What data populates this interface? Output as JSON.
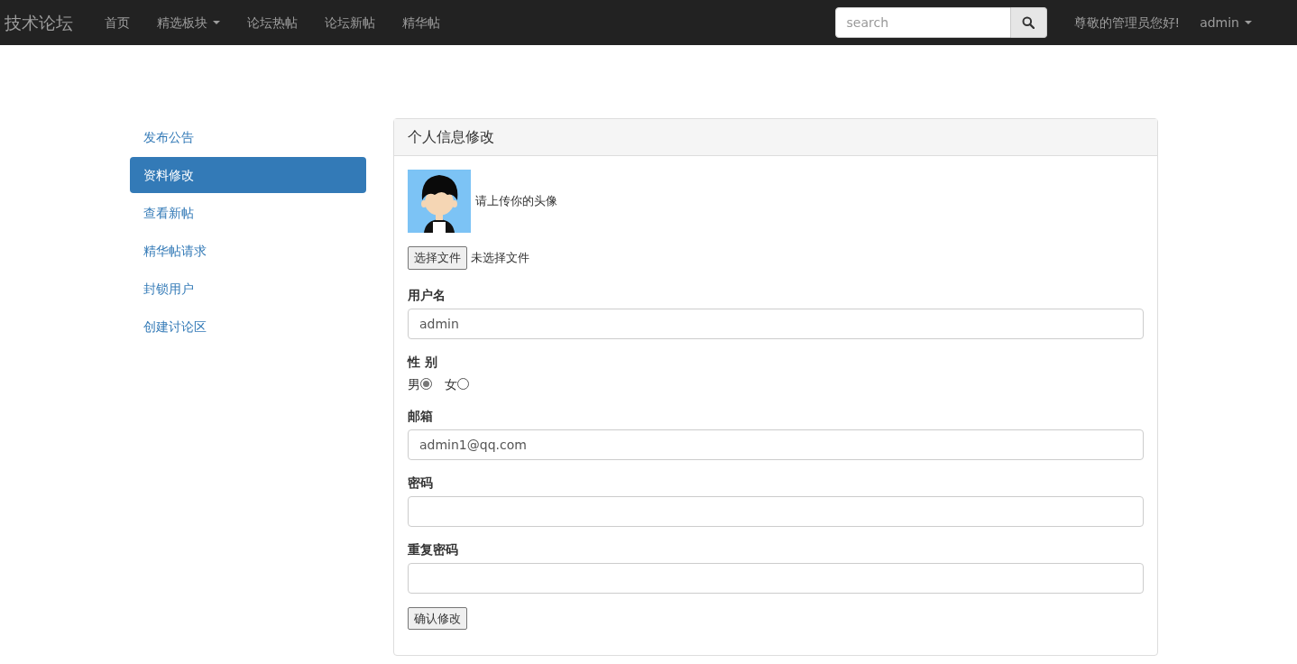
{
  "navbar": {
    "brand": "技术论坛",
    "items": [
      {
        "label": "首页",
        "dropdown": false
      },
      {
        "label": "精选板块",
        "dropdown": true
      },
      {
        "label": "论坛热帖",
        "dropdown": false
      },
      {
        "label": "论坛新帖",
        "dropdown": false
      },
      {
        "label": "精华帖",
        "dropdown": false
      }
    ],
    "search": {
      "placeholder": "search"
    },
    "greeting": "尊敬的管理员您好!",
    "user_menu": "admin"
  },
  "sidebar": {
    "items": [
      {
        "label": "发布公告",
        "selected": false
      },
      {
        "label": "资料修改",
        "selected": true
      },
      {
        "label": "查看新帖",
        "selected": false
      },
      {
        "label": "精华帖请求",
        "selected": false
      },
      {
        "label": "封锁用户",
        "selected": false
      },
      {
        "label": "创建讨论区",
        "selected": false
      }
    ]
  },
  "panel": {
    "title": "个人信息修改",
    "avatar": {
      "kind": "picture",
      "hint": "请上传你的头像"
    },
    "file_button": "选择文件",
    "file_status": "未选择文件",
    "fields": [
      {
        "kind": "text",
        "label": "用户名",
        "value": "admin"
      },
      {
        "kind": "radio",
        "label": "性 别",
        "options": [
          {
            "label": "男",
            "selected": true
          },
          {
            "label": "女",
            "selected": false
          }
        ]
      },
      {
        "kind": "text",
        "label": "邮箱",
        "value": "admin1@qq.com"
      },
      {
        "kind": "password",
        "label": "密码"
      },
      {
        "kind": "password",
        "label": "重复密码"
      }
    ],
    "submit": "确认修改"
  }
}
